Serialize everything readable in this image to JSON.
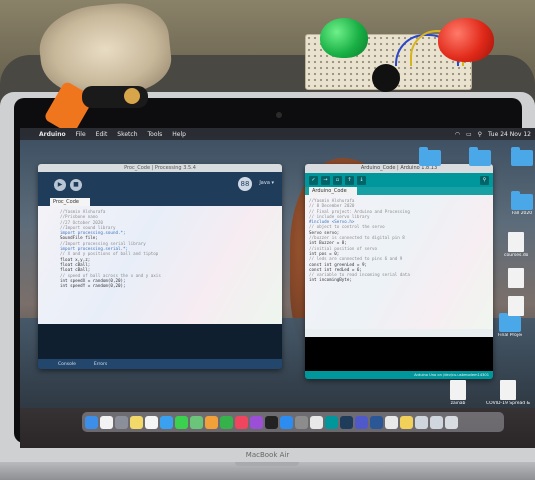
{
  "menubar": {
    "apple": "",
    "app_name": "Arduino",
    "items": [
      "File",
      "Edit",
      "Sketch",
      "Tools",
      "Help"
    ],
    "clock": "Tue 24 Nov 12"
  },
  "processing": {
    "title": "Proc_Code | Processing 3.5.4",
    "mode": "Java ▾",
    "badge": "88",
    "tab": "Proc_Code",
    "code": [
      {
        "t": "//Yasmin Alshurafa",
        "c": "cm"
      },
      {
        "t": "//Prisbone nano",
        "c": "cm"
      },
      {
        "t": "//27 October 2020",
        "c": "cm"
      },
      {
        "t": "",
        "c": ""
      },
      {
        "t": "//Import sound library",
        "c": "cm"
      },
      {
        "t": "import processing.sound.*;",
        "c": "kw"
      },
      {
        "t": "SoundFile file;",
        "c": ""
      },
      {
        "t": "",
        "c": ""
      },
      {
        "t": "//Import processing serial library",
        "c": "cm"
      },
      {
        "t": "import processing.serial.*;",
        "c": "kw"
      },
      {
        "t": "",
        "c": ""
      },
      {
        "t": "// X and y positions of ball and tiptop",
        "c": "cm"
      },
      {
        "t": "float x,y,z;",
        "c": ""
      },
      {
        "t": "float cBall;",
        "c": ""
      },
      {
        "t": "float cBall;",
        "c": ""
      },
      {
        "t": "",
        "c": ""
      },
      {
        "t": "// speed of ball across the x and y axis",
        "c": "cm"
      },
      {
        "t": "int speedX = random(0,20);",
        "c": ""
      },
      {
        "t": "int speedY = random(0,20);",
        "c": ""
      }
    ],
    "console_tab": "Console",
    "errors_tab": "Errors"
  },
  "arduino": {
    "title": "Arduino_Code | Arduino 1.8.13",
    "tab": "Arduino_Code",
    "code": [
      {
        "t": "//Yasmin Alshurafa",
        "c": "cm"
      },
      {
        "t": "// 8 December 2020",
        "c": "cm"
      },
      {
        "t": "// Final project: Arduino and Processing",
        "c": "cm"
      },
      {
        "t": "",
        "c": ""
      },
      {
        "t": "// include servo library",
        "c": "cm"
      },
      {
        "t": "#include <Servo.h>",
        "c": "kw"
      },
      {
        "t": "",
        "c": ""
      },
      {
        "t": "// object to control the servo",
        "c": "cm"
      },
      {
        "t": "Servo servo;",
        "c": ""
      },
      {
        "t": "",
        "c": ""
      },
      {
        "t": "//buzzer is connected to digital pin 8",
        "c": "cm"
      },
      {
        "t": "int Buzzer = 8;",
        "c": ""
      },
      {
        "t": "",
        "c": ""
      },
      {
        "t": "//initial position of servo",
        "c": "cm"
      },
      {
        "t": "int pos = 0;",
        "c": ""
      },
      {
        "t": "",
        "c": ""
      },
      {
        "t": "// leds are connected to pins 6 and 9",
        "c": "cm"
      },
      {
        "t": "const int greenLed = 9;",
        "c": ""
      },
      {
        "t": "const int redLed = 6;",
        "c": ""
      },
      {
        "t": "",
        "c": ""
      },
      {
        "t": "// variable to read incoming serial data",
        "c": "cm"
      },
      {
        "t": "int incomingByte;",
        "c": ""
      }
    ],
    "status": "Arduino Uno on /dev/cu.usbmodem14301"
  },
  "desktop_icons": [
    {
      "label": "",
      "kind": "folder"
    },
    {
      "label": "",
      "kind": "folder"
    },
    {
      "label": "",
      "kind": "folder"
    },
    {
      "label": "Fall 2020",
      "kind": "folder"
    },
    {
      "label": "courses.docx",
      "kind": "doc"
    },
    {
      "label": "",
      "kind": "doc"
    },
    {
      "label": "",
      "kind": "doc"
    },
    {
      "label": "Final Project",
      "kind": "folder"
    },
    {
      "label": "zainab",
      "kind": "doc"
    },
    {
      "label": "COVID-19 Spread & Conta...ivid.pptx",
      "kind": "doc"
    }
  ],
  "dock_apps": [
    {
      "name": "finder-app",
      "color": "#3d8ee8"
    },
    {
      "name": "calendar-app",
      "color": "#f3f3f3"
    },
    {
      "name": "launchpad-app",
      "color": "#8a8f9a"
    },
    {
      "name": "notes-app",
      "color": "#f2d96a"
    },
    {
      "name": "reminders-app",
      "color": "#f5f5f5"
    },
    {
      "name": "safari-app",
      "color": "#3aa0f0"
    },
    {
      "name": "messages-app",
      "color": "#3bd14e"
    },
    {
      "name": "maps-app",
      "color": "#6ac57a"
    },
    {
      "name": "photos-app",
      "color": "#f2a03a"
    },
    {
      "name": "facetime-app",
      "color": "#36b24a"
    },
    {
      "name": "music-app",
      "color": "#f0455f"
    },
    {
      "name": "podcasts-app",
      "color": "#9a4fd6"
    },
    {
      "name": "appletv-app",
      "color": "#222222"
    },
    {
      "name": "appstore-app",
      "color": "#2d8cf0"
    },
    {
      "name": "preferences-app",
      "color": "#8c8c8c"
    },
    {
      "name": "chrome-app",
      "color": "#e8e8e8"
    },
    {
      "name": "arduino-app",
      "color": "#00979c"
    },
    {
      "name": "processing-app",
      "color": "#1f3c5b"
    },
    {
      "name": "teams-app",
      "color": "#5059c9"
    },
    {
      "name": "word-app",
      "color": "#2b5797"
    },
    {
      "name": "preview-app",
      "color": "#e9e9e9"
    },
    {
      "name": "stickies-app",
      "color": "#f2d15a"
    },
    {
      "name": "window-app",
      "color": "#cfd6dd"
    },
    {
      "name": "window-app-2",
      "color": "#cfd6dd"
    },
    {
      "name": "trash-app",
      "color": "#d8dbe0"
    }
  ],
  "laptop": {
    "brand": "MacBook Air"
  },
  "colors": {
    "arduino_teal": "#00979c",
    "processing_blue": "#1f3c5b",
    "led_green": "#19b045",
    "led_red": "#e12a1a"
  }
}
